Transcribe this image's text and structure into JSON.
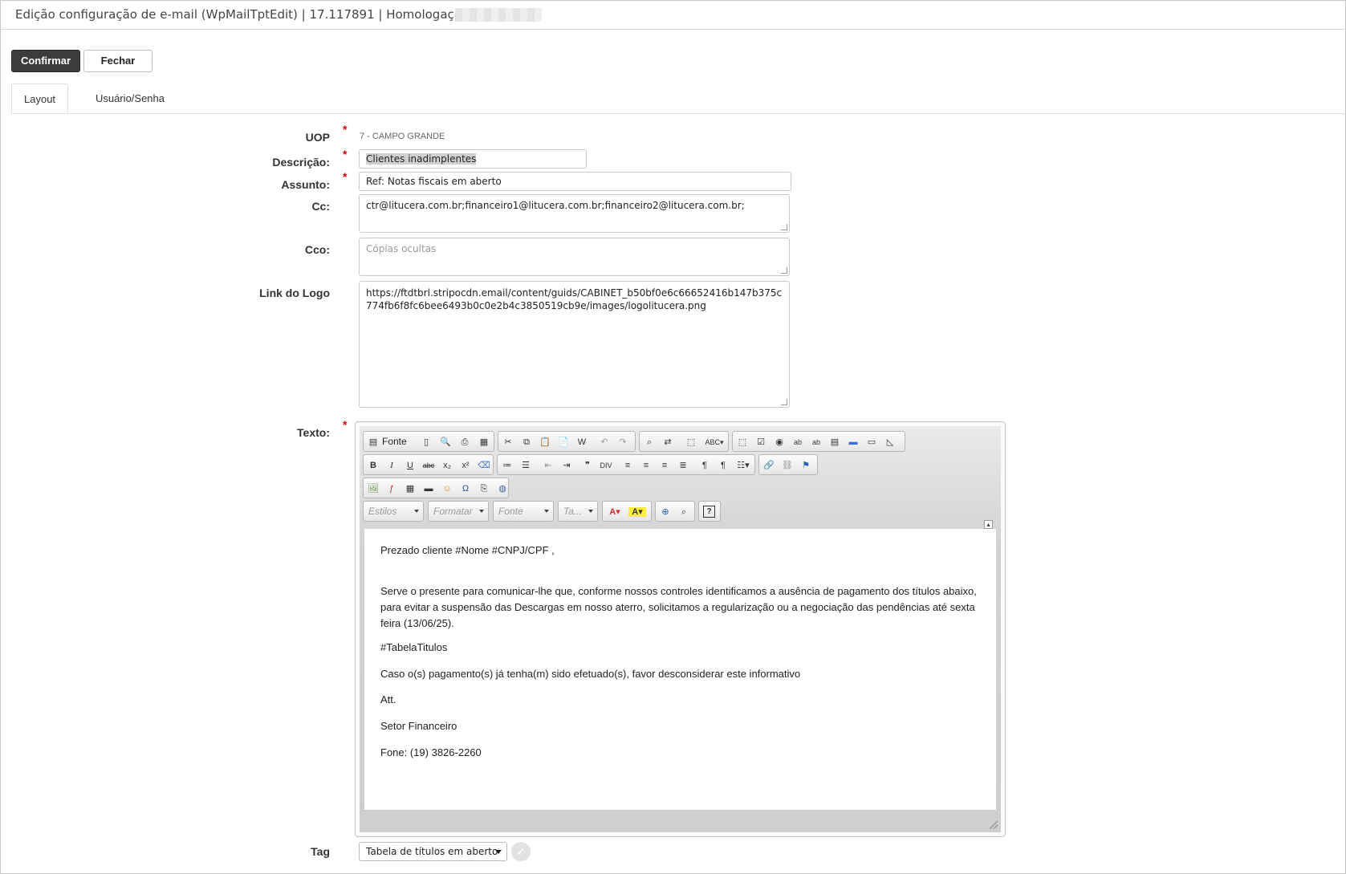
{
  "window": {
    "title": "Edição configuração de e-mail (WpMailTptEdit) | 17.117891 | Homologação |"
  },
  "actions": {
    "confirm_label": "Confirmar",
    "close_label": "Fechar"
  },
  "tabs": [
    {
      "label": "Layout",
      "active": true
    },
    {
      "label": "Usuário/Senha",
      "active": false
    }
  ],
  "form": {
    "uop_label": "UOP",
    "uop_value": "7 - CAMPO GRANDE",
    "descricao_label": "Descrição:",
    "descricao_value": "Clientes inadimplentes",
    "assunto_label": "Assunto:",
    "assunto_value": "Ref: Notas fiscais em aberto",
    "cc_label": "Cc:",
    "cc_value": "ctr@litucera.com.br;financeiro1@litucera.com.br;financeiro2@litucera.com.br;",
    "cco_label": "Cco:",
    "cco_placeholder": "Cópias ocultas",
    "logo_label": "Link do Logo",
    "logo_value": "https://ftdtbrl.stripocdn.email/content/guids/CABINET_b50bf0e6c66652416b147b375c774fb6f8fc6bee6493b0c0e2b4c3850519cb9e/images/logolitucera.png",
    "texto_label": "Texto:",
    "tag_label": "Tag",
    "tag_selected": "Tabela de títulos em aberto",
    "required_mark": "*"
  },
  "editor": {
    "source_label": "Fonte",
    "combos": {
      "styles": "Estilos",
      "format": "Formatar",
      "font": "Fonte",
      "size": "Ta..."
    },
    "content": [
      "Prezado cliente #Nome #CNPJ/CPF ,",
      "Serve o presente para comunicar-lhe que, conforme nossos controles identificamos a ausência de pagamento dos títulos abaixo, para evitar a suspensão das Descargas em nosso aterro, solicitamos a regularização ou a negociação das pendências  até sexta feira (13/06/25).",
      "#TabelaTitulos",
      "Caso o(s) pagamento(s) já tenha(m) sido efetuado(s), favor desconsiderar este informativo",
      "Att.",
      "Setor Financeiro",
      "Fone: (19) 3826-2260"
    ]
  },
  "icons": {
    "required": "red asterisk",
    "add_tag": "check-circle-icon"
  },
  "colors": {
    "primary_button": "#3c3c3c",
    "required": "#dd0000",
    "editor_toolbar": "#d5d5d5"
  }
}
